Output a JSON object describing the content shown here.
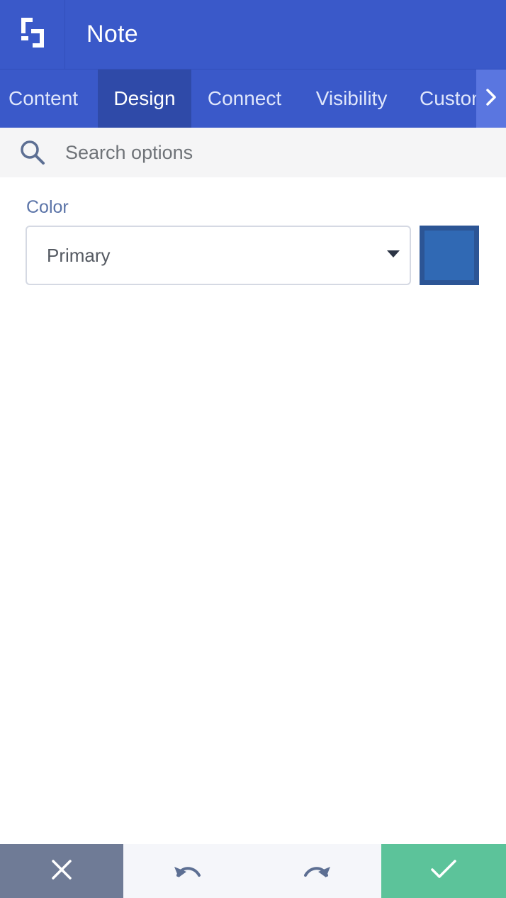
{
  "header": {
    "logo_icon": "builder-logo-icon",
    "title": "Note"
  },
  "tabs": [
    {
      "label": "Content",
      "active": false
    },
    {
      "label": "Design",
      "active": true
    },
    {
      "label": "Connect",
      "active": false
    },
    {
      "label": "Visibility",
      "active": false
    },
    {
      "label": "Custom",
      "active": false
    }
  ],
  "tabs_scroll_icon": "chevron-right-icon",
  "search": {
    "icon": "search-icon",
    "placeholder": "Search options",
    "value": ""
  },
  "color_field": {
    "label": "Color",
    "selected": "Primary",
    "swatch_color": "#3069b4"
  },
  "footer": {
    "cancel_icon": "close-icon",
    "undo_icon": "undo-icon",
    "redo_icon": "redo-icon",
    "save_icon": "checkmark-icon"
  },
  "colors": {
    "header": "#3a59c9",
    "active_tab": "#2f4aa8",
    "cancel": "#6f7b96",
    "save": "#5cc39a",
    "label": "#5b74a8"
  }
}
